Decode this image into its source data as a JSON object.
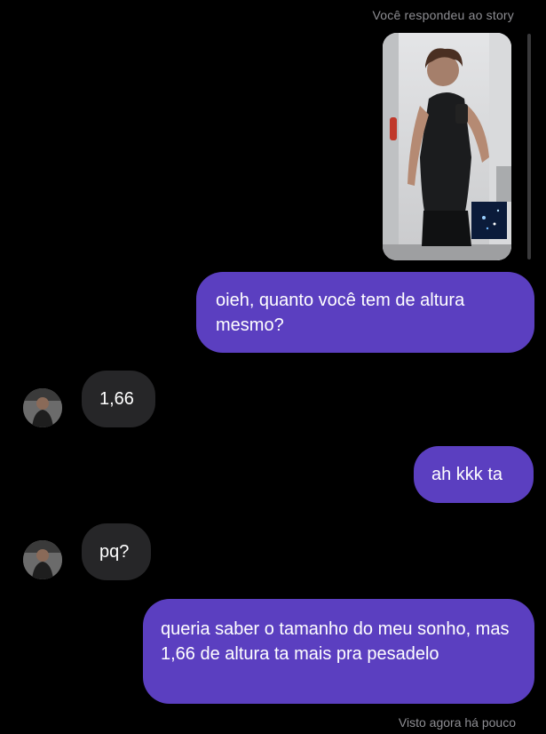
{
  "story_reply": {
    "caption": "Você respondeu ao story",
    "thumbnail": "mirror-selfie-gym-photo"
  },
  "messages": [
    {
      "from": "me",
      "text": "oieh, quanto você tem de altura mesmo?"
    },
    {
      "from": "them",
      "text": "1,66"
    },
    {
      "from": "me",
      "text": "ah kkk ta"
    },
    {
      "from": "them",
      "text": "pq?"
    },
    {
      "from": "me",
      "text": "queria saber o tamanho do meu sonho, mas 1,66 de altura ta mais pra pesadelo"
    }
  ],
  "status": {
    "seen": "Visto agora há pouco"
  },
  "colors": {
    "background": "#000000",
    "sent_bubble": "#5b3fc0",
    "received_bubble": "#262628",
    "meta_text": "#8e8e93"
  }
}
